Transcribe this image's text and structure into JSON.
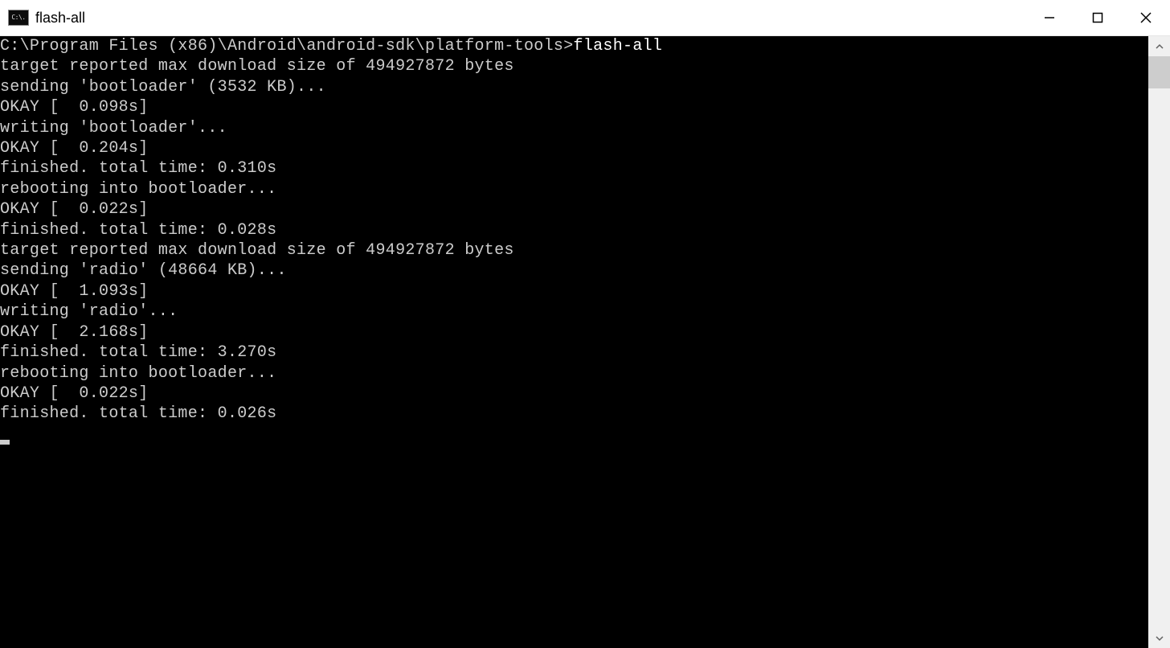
{
  "window": {
    "title": "flash-all",
    "icon_glyph": "C:\\."
  },
  "terminal": {
    "prompt_path": "C:\\Program Files (x86)\\Android\\android-sdk\\platform-tools>",
    "prompt_command": "flash-all",
    "lines": [
      "target reported max download size of 494927872 bytes",
      "sending 'bootloader' (3532 KB)...",
      "OKAY [  0.098s]",
      "writing 'bootloader'...",
      "OKAY [  0.204s]",
      "finished. total time: 0.310s",
      "rebooting into bootloader...",
      "OKAY [  0.022s]",
      "finished. total time: 0.028s",
      "target reported max download size of 494927872 bytes",
      "sending 'radio' (48664 KB)...",
      "OKAY [  1.093s]",
      "writing 'radio'...",
      "OKAY [  2.168s]",
      "finished. total time: 3.270s",
      "rebooting into bootloader...",
      "OKAY [  0.022s]",
      "finished. total time: 0.026s"
    ]
  }
}
